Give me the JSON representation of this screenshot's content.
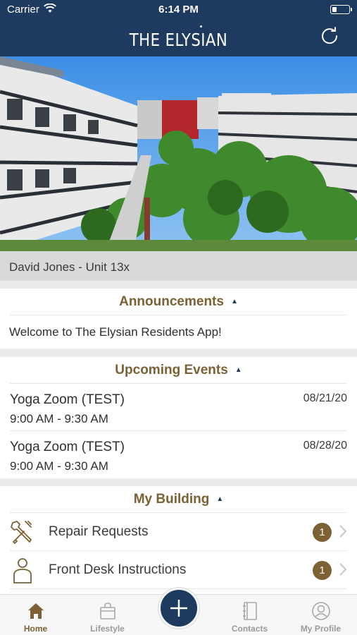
{
  "status_bar": {
    "carrier": "Carrier",
    "time": "6:14 PM"
  },
  "header": {
    "title": "THE ELYSIAN"
  },
  "resident": {
    "label": "David Jones - Unit 13x"
  },
  "announcements": {
    "title": "Announcements",
    "items": [
      "Welcome to The Elysian Residents App!"
    ]
  },
  "events": {
    "title": "Upcoming Events",
    "items": [
      {
        "name": "Yoga Zoom (TEST)",
        "hours": "9:00 AM - 9:30 AM",
        "date": "08/21/20"
      },
      {
        "name": "Yoga Zoom (TEST)",
        "hours": "9:00 AM - 9:30 AM",
        "date": "08/28/20"
      }
    ]
  },
  "building": {
    "title": "My Building",
    "items": [
      {
        "label": "Repair Requests",
        "badge": "1",
        "icon": "tools-icon"
      },
      {
        "label": "Front Desk Instructions",
        "badge": "1",
        "icon": "person-icon"
      }
    ]
  },
  "tabs": [
    {
      "label": "Home",
      "icon": "home-icon",
      "active": true
    },
    {
      "label": "Lifestyle",
      "icon": "bag-icon",
      "active": false
    },
    {
      "label": "Contacts",
      "icon": "book-icon",
      "active": false
    },
    {
      "label": "My Profile",
      "icon": "profile-icon",
      "active": false
    }
  ],
  "colors": {
    "navy": "#1e3a5f",
    "gold": "#7b6134"
  }
}
